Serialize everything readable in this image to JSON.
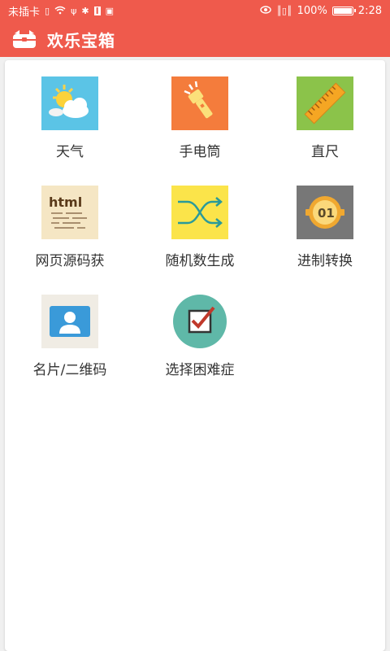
{
  "status_bar": {
    "carrier": "未插卡",
    "battery": "100%",
    "time": "2:28"
  },
  "app_bar": {
    "title": "欢乐宝箱",
    "icon": "toolbox-icon"
  },
  "tools": [
    {
      "label": "天气",
      "icon": "weather-icon",
      "color": "#5bc4e6"
    },
    {
      "label": "手电筒",
      "icon": "flashlight-icon",
      "color": "#f47c3c"
    },
    {
      "label": "直尺",
      "icon": "ruler-icon",
      "color": "#8bc34a"
    },
    {
      "label": "网页源码获",
      "icon": "html-source-icon",
      "color": "#f5e6c4"
    },
    {
      "label": "随机数生成",
      "icon": "shuffle-icon",
      "color": "#fbe44a"
    },
    {
      "label": "进制转换",
      "icon": "number-base-icon",
      "color": "#777777"
    },
    {
      "label": "名片/二维码",
      "icon": "business-card-icon",
      "color": "#f0ece4"
    },
    {
      "label": "选择困难症",
      "icon": "checkbox-decision-icon",
      "color": "#5fb8a8"
    }
  ]
}
